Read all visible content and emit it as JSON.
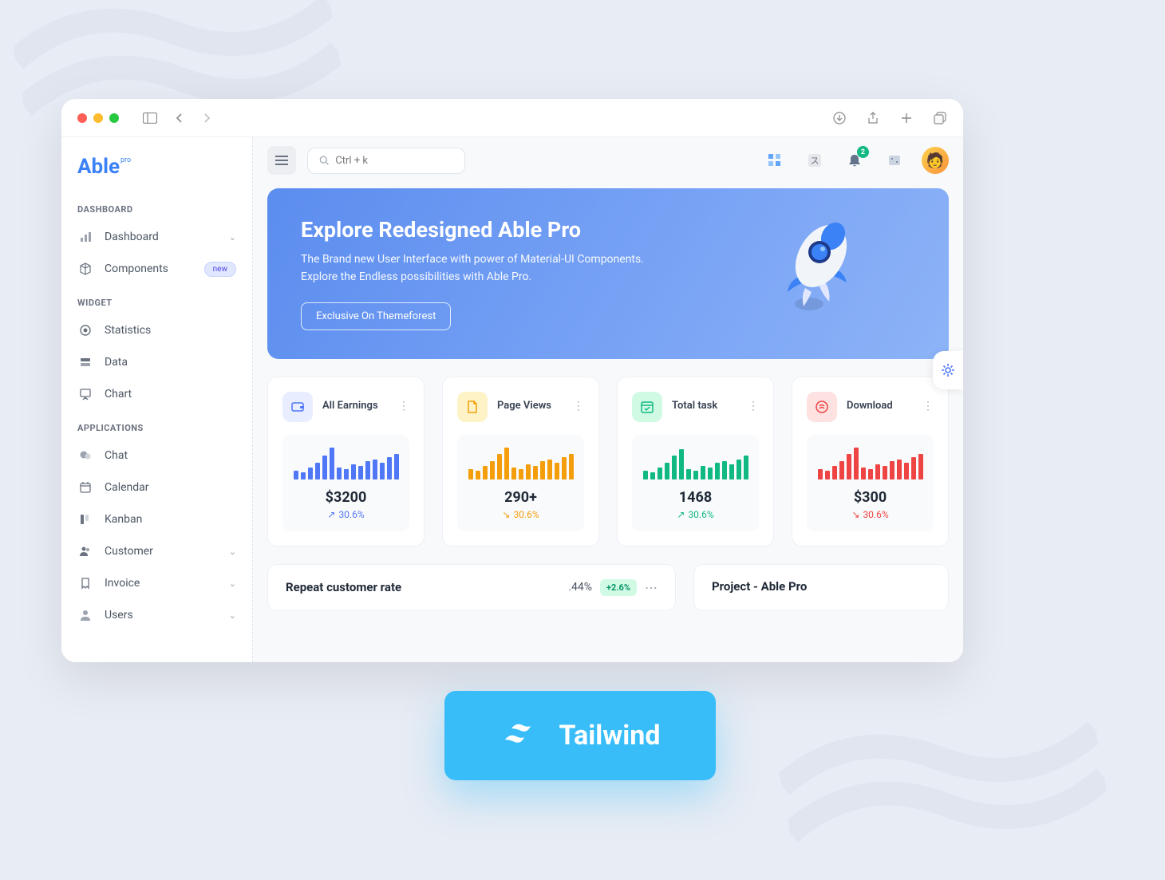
{
  "brand": {
    "name": "Able",
    "suffix": "pro"
  },
  "sidebar": {
    "sections": [
      {
        "label": "DASHBOARD",
        "items": [
          {
            "icon": "chart-icon",
            "label": "Dashboard",
            "hasChevron": true
          },
          {
            "icon": "cube-icon",
            "label": "Components",
            "badge": "new"
          }
        ]
      },
      {
        "label": "WIDGET",
        "items": [
          {
            "icon": "target-icon",
            "label": "Statistics"
          },
          {
            "icon": "server-icon",
            "label": "Data"
          },
          {
            "icon": "presentation-icon",
            "label": "Chart"
          }
        ]
      },
      {
        "label": "APPLICATIONS",
        "items": [
          {
            "icon": "chat-icon",
            "label": "Chat"
          },
          {
            "icon": "calendar-icon",
            "label": "Calendar"
          },
          {
            "icon": "kanban-icon",
            "label": "Kanban"
          },
          {
            "icon": "users-icon",
            "label": "Customer",
            "hasChevron": true
          },
          {
            "icon": "invoice-icon",
            "label": "Invoice",
            "hasChevron": true
          },
          {
            "icon": "user-icon",
            "label": "Users",
            "hasChevron": true
          }
        ]
      }
    ]
  },
  "search": {
    "placeholder": "Ctrl + k"
  },
  "notifications": {
    "count": "2"
  },
  "hero": {
    "title": "Explore Redesigned Able Pro",
    "line1": "The Brand new User Interface with power of Material-UI Components.",
    "line2": "Explore the Endless possibilities with Able Pro.",
    "cta": "Exclusive On Themeforest"
  },
  "stats": [
    {
      "title": "All Earnings",
      "value": "$3200",
      "change": "30.6%",
      "trend": "up",
      "color": "#4f77f6",
      "iconBg": "#e8edff",
      "icon": "wallet-icon"
    },
    {
      "title": "Page Views",
      "value": "290+",
      "change": "30.6%",
      "trend": "down",
      "color": "#f59e0b",
      "iconBg": "#fef3c7",
      "icon": "file-icon"
    },
    {
      "title": "Total task",
      "value": "1468",
      "change": "30.6%",
      "trend": "up",
      "color": "#10b981",
      "iconBg": "#d1fae5",
      "icon": "calendar-check-icon"
    },
    {
      "title": "Download",
      "value": "$300",
      "change": "30.6%",
      "trend": "down",
      "color": "#ef4444",
      "iconBg": "#fee2e2",
      "icon": "download-icon"
    }
  ],
  "chart_data": [
    {
      "type": "bar",
      "title": "All Earnings",
      "values": [
        10,
        8,
        14,
        20,
        28,
        38,
        14,
        12,
        18,
        16,
        22,
        24,
        20,
        26,
        30
      ],
      "ylim": [
        0,
        40
      ]
    },
    {
      "type": "bar",
      "title": "Page Views",
      "values": [
        12,
        10,
        16,
        22,
        30,
        38,
        14,
        12,
        18,
        16,
        22,
        24,
        20,
        26,
        30
      ],
      "ylim": [
        0,
        40
      ]
    },
    {
      "type": "bar",
      "title": "Total task",
      "values": [
        10,
        8,
        14,
        20,
        28,
        36,
        12,
        10,
        16,
        14,
        20,
        22,
        18,
        24,
        28
      ],
      "ylim": [
        0,
        40
      ]
    },
    {
      "type": "bar",
      "title": "Download",
      "values": [
        12,
        10,
        16,
        22,
        30,
        38,
        14,
        12,
        18,
        16,
        22,
        24,
        20,
        26,
        30
      ],
      "ylim": [
        0,
        40
      ]
    }
  ],
  "panels": {
    "repeat": {
      "title": "Repeat customer rate",
      "stat": ".44%",
      "badge": "+2.6%"
    },
    "project": {
      "title": "Project - Able Pro"
    }
  },
  "overlay": {
    "label": "Tailwind"
  }
}
